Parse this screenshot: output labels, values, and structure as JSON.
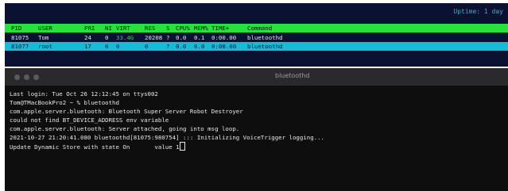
{
  "htop": {
    "uptime": "Uptime: 1 day",
    "header": {
      "pid": "PID",
      "user": "USER",
      "pri": "PRI",
      "ni": "NI",
      "virt": "VIRT",
      "res": "RES",
      "s": "S",
      "cpu": "CPU%",
      "mem": "MEM%",
      "time": "TIME+",
      "command": "Command"
    },
    "processes": [
      {
        "pid": "81075",
        "user": "Tom",
        "pri": "24",
        "ni": "0",
        "virt": "33.4G",
        "res": "20208",
        "s": "?",
        "cpu": "0.0",
        "mem": "0.1",
        "time": "0:00.00",
        "command": "bluetoothd"
      },
      {
        "pid": "81077",
        "user": "root",
        "pri": "17",
        "ni": "0",
        "virt": "0",
        "res": "0",
        "s": "?",
        "cpu": "0.0",
        "mem": "0.0",
        "time": "0:00.00",
        "command": "bluetoothd"
      }
    ],
    "colors": {
      "background": "#0b1130",
      "header_bg": "#27e23a",
      "selected_bg": "#15bcd7",
      "virt_accent": "#31c85e"
    }
  },
  "terminal": {
    "title": "bluetoothd",
    "lines": [
      "Last login: Tue Oct 26 12:12:45 on ttys002",
      "Tom@TMacBookPro2 ~ % bluetoothd",
      "com.apple.server.bluetooth: Bluetooth Super Server Robot Destroyer",
      "could not find BT_DEVICE_ADDRESS env variable",
      "com.apple.server.bluetooth: Server attached, going into msg loop.",
      "2021-10-27 21:20:41.080 bluetoothd[81075:980754] ::: Initializing VoiceTrigger logging...",
      "Update Dynamic Store with state On       value 1"
    ],
    "colors": {
      "background": "#0e0e0e",
      "titlebar": "#2a2a2c"
    }
  }
}
